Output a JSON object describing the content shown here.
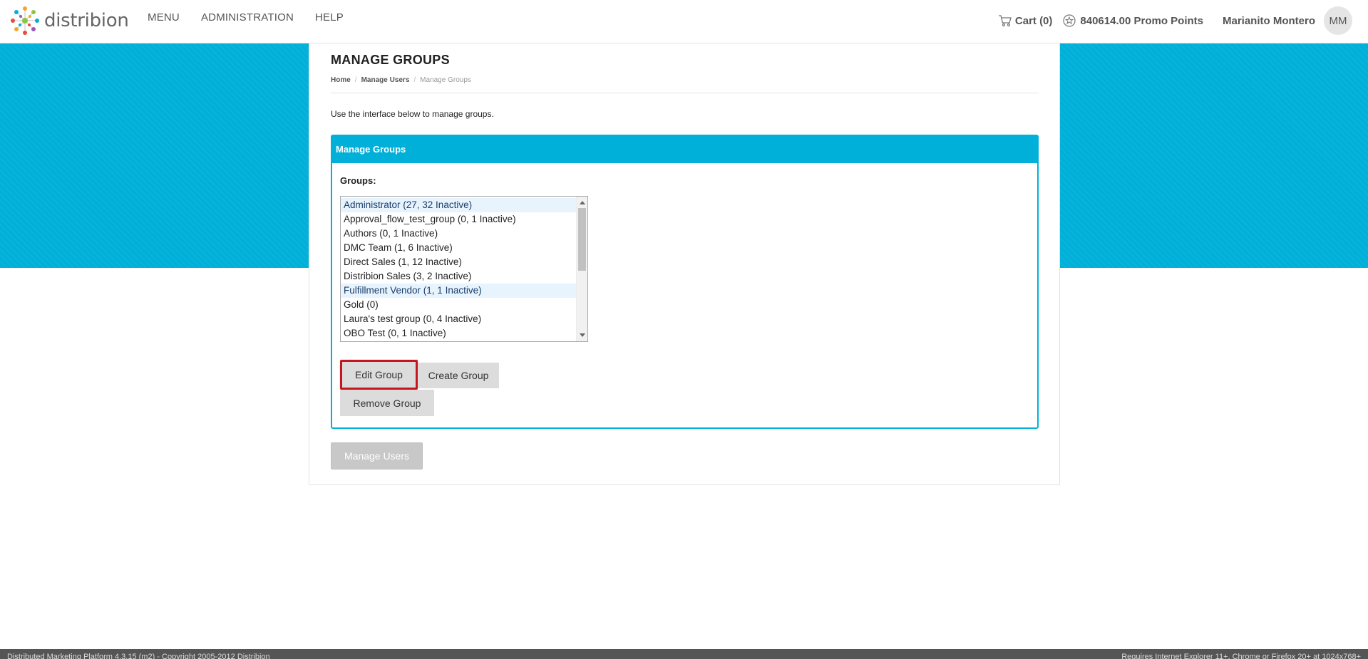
{
  "brand": {
    "name": "distribion"
  },
  "nav": {
    "items": [
      {
        "label": "MENU"
      },
      {
        "label": "ADMINISTRATION"
      },
      {
        "label": "HELP"
      }
    ]
  },
  "header": {
    "cart_label": "Cart (0)",
    "points_label": "840614.00 Promo Points",
    "user_name": "Marianito Montero",
    "user_initials": "MM"
  },
  "page": {
    "title": "MANAGE GROUPS",
    "breadcrumb": [
      "Home",
      "Manage Users",
      "Manage Groups"
    ],
    "intro": "Use the interface below to manage groups."
  },
  "panel": {
    "title": "Manage Groups",
    "groups_label": "Groups:",
    "groups": [
      {
        "label": "Administrator (27, 32 Inactive)",
        "selected": true
      },
      {
        "label": "Approval_flow_test_group (0, 1 Inactive)",
        "selected": false
      },
      {
        "label": "Authors (0, 1 Inactive)",
        "selected": false
      },
      {
        "label": "DMC Team (1, 6 Inactive)",
        "selected": false
      },
      {
        "label": "Direct Sales (1, 12 Inactive)",
        "selected": false
      },
      {
        "label": "Distribion Sales (3, 2 Inactive)",
        "selected": false
      },
      {
        "label": "Fulfillment Vendor (1, 1 Inactive)",
        "selected": true
      },
      {
        "label": "Gold (0)",
        "selected": false
      },
      {
        "label": "Laura's test group (0, 4 Inactive)",
        "selected": false
      },
      {
        "label": "OBO Test (0, 1 Inactive)",
        "selected": false
      }
    ],
    "edit_label": "Edit Group",
    "create_label": "Create Group",
    "remove_label": "Remove Group"
  },
  "manage_users_label": "Manage Users",
  "footer": {
    "left": "Distributed Marketing Platform 4.3.15 (m2) - Copyright 2005-2012 Distribion",
    "right": "Requires Internet Explorer 11+, Chrome or Firefox 20+ at 1024x768+"
  },
  "colors": {
    "accent": "#00b0d9",
    "highlight_border": "#c4161c",
    "footer_bg": "#555555"
  }
}
